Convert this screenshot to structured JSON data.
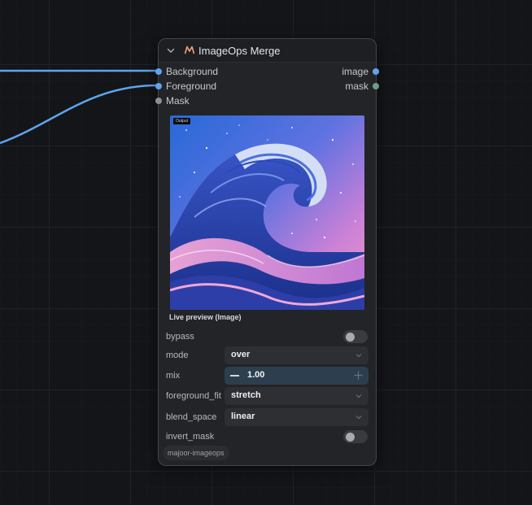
{
  "node": {
    "title": "ImageOps Merge",
    "inputs": [
      {
        "label": "Background",
        "connected": true
      },
      {
        "label": "Foreground",
        "connected": true
      },
      {
        "label": "Mask",
        "connected": false
      }
    ],
    "outputs": [
      {
        "label": "image"
      },
      {
        "label": "mask"
      }
    ],
    "preview": {
      "tag": "Output",
      "caption": "Live preview (Image)"
    },
    "widgets": {
      "bypass": {
        "label": "bypass",
        "value": false
      },
      "mode": {
        "label": "mode",
        "value": "over"
      },
      "mix": {
        "label": "mix",
        "value": "1.00"
      },
      "foreground_fit": {
        "label": "foreground_fit",
        "value": "stretch"
      },
      "blend_space": {
        "label": "blend_space",
        "value": "linear"
      },
      "invert_mask": {
        "label": "invert_mask",
        "value": false
      }
    },
    "badge": "majoor-imageops"
  },
  "colors": {
    "link": "#5ea4ee",
    "canvas": "#141518",
    "node_bg": "#232427",
    "accent_number": "#2d3f4f"
  }
}
